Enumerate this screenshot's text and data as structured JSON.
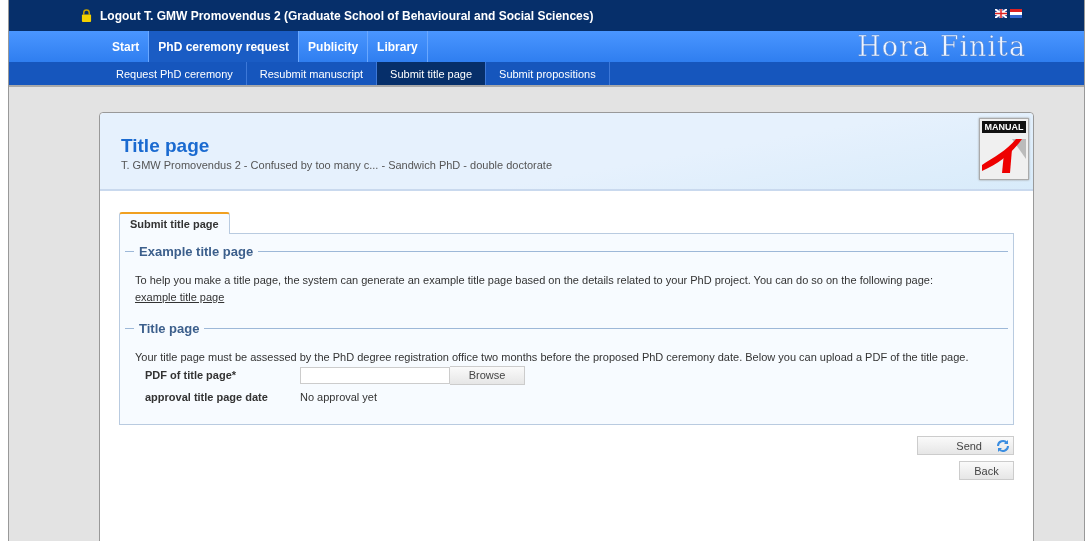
{
  "top_bar": {
    "user_text": "Logout T. GMW Promovendus 2 (Graduate School of Behavioural and Social Sciences)"
  },
  "main_nav": [
    {
      "label": "Start",
      "selected": false
    },
    {
      "label": "PhD ceremony request",
      "selected": true
    },
    {
      "label": "Publicity",
      "selected": false
    },
    {
      "label": "Library",
      "selected": false
    }
  ],
  "logo": "Hora Finita",
  "sub_nav": [
    {
      "label": "Request PhD ceremony",
      "selected": false
    },
    {
      "label": "Resubmit manuscript",
      "selected": false
    },
    {
      "label": "Submit title page",
      "selected": true
    },
    {
      "label": "Submit propositions",
      "selected": false
    }
  ],
  "page": {
    "title": "Title page",
    "subtitle": "T. GMW Promovendus 2 - Confused by too many c... - Sandwich PhD - double doctorate",
    "manual_label": "MANUAL"
  },
  "tabs": [
    {
      "label": "Submit title page",
      "selected": true
    }
  ],
  "sections": [
    {
      "legend": "Example title page",
      "text": "To help you make a title page, the system can generate an example title page based on the details related to your PhD project. You can do so on the following page:",
      "link": "example title page"
    },
    {
      "legend": "Title page",
      "text": "Your title page must be assessed by the PhD degree registration office two months before the proposed PhD ceremony date. Below you can upload a PDF of the title page.",
      "fields": [
        {
          "kind": "file",
          "label": "PDF of title page*",
          "button": "Browse"
        },
        {
          "kind": "static",
          "label": "approval title page date",
          "value": "No approval yet"
        }
      ]
    }
  ],
  "buttons": [
    {
      "kind": "send",
      "label": "Send"
    },
    {
      "kind": "plain",
      "label": "Back"
    }
  ]
}
